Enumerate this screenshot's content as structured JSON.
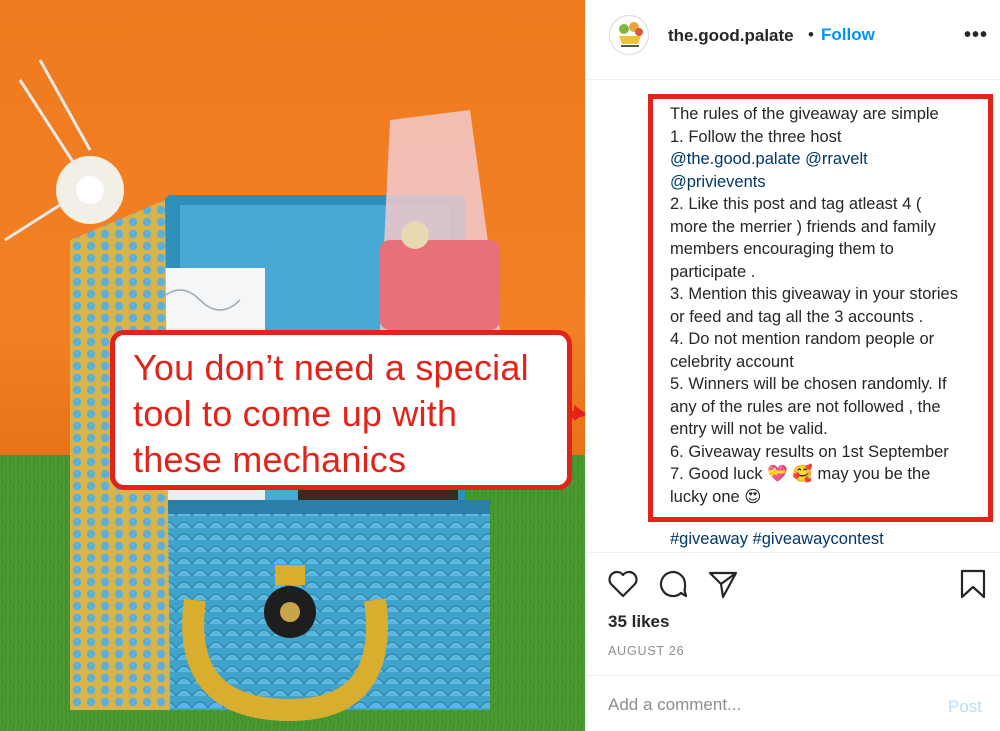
{
  "photo": {
    "callout_lines": [
      "You don’t need a special",
      "tool to come up with",
      "these mechanics"
    ]
  },
  "post": {
    "username": "the.good.palate",
    "separator": "•",
    "follow_label": "Follow",
    "more_label": "•••",
    "caption_lines": [
      "The rules of the giveaway are simple",
      "1. Follow the three host",
      "@the.good.palate @rravelt",
      "@privievents",
      "2. Like this post and tag atleast 4 (",
      "more the merrier ) friends and family",
      "members encouraging them to",
      "participate .",
      "3. Mention this giveaway in your stories",
      "or feed and tag all the 3 accounts .",
      "4. Do not mention random people or",
      "celebrity account",
      "5. Winners will be chosen randomly. If",
      "any of the rules are not followed , the",
      "entry will not be valid.",
      "6. Giveaway results on 1st September",
      "7. Good luck 💝 🥰 may you be the",
      "lucky one 😍"
    ],
    "hashtags": "#giveaway #giveawaycontest",
    "likes": "35 likes",
    "date": "AUGUST 26",
    "comment_placeholder": "Add a comment...",
    "post_label": "Post"
  },
  "icons": [
    "heart-icon",
    "comment-icon",
    "share-icon",
    "bookmark-icon",
    "more-options-icon",
    "avatar-logo-icon",
    "arrow-icon"
  ],
  "colors": {
    "accent_red": "#e2231a",
    "follow_blue": "#0095f6",
    "mention_blue": "#00376b",
    "post_disabled": "#b2dffc",
    "muted": "#8e8e8e"
  }
}
